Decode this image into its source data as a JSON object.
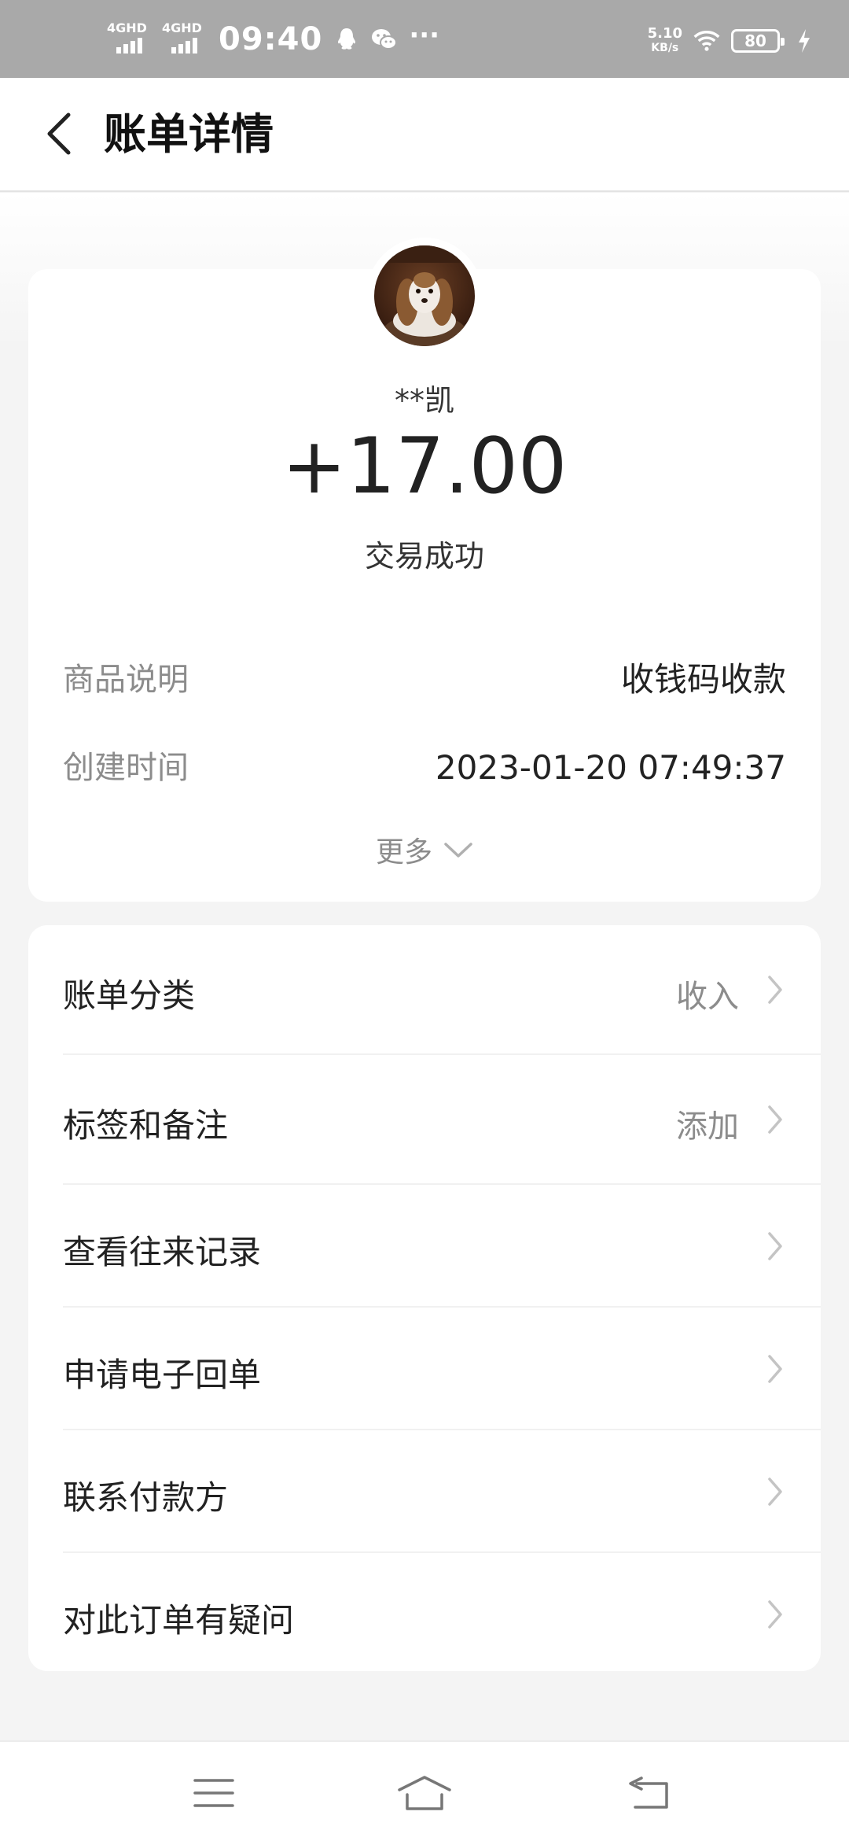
{
  "status_bar": {
    "sim1": "4GHD",
    "sim2": "4GHD",
    "time": "09:40",
    "icons": [
      "qq-icon",
      "wechat-icon",
      "more-dots-icon"
    ],
    "dots": "···",
    "net_speed": "5.10",
    "net_unit": "KB/s",
    "battery": "80"
  },
  "header": {
    "title": "账单详情",
    "back_icon": "chevron-left-icon"
  },
  "summary": {
    "payer": "**凯",
    "amount": "+17.00",
    "status": "交易成功",
    "details": [
      {
        "key": "商品说明",
        "value": "收钱码收款"
      },
      {
        "key": "创建时间",
        "value": "2023-01-20 07:49:37"
      }
    ],
    "more_label": "更多"
  },
  "actions": [
    {
      "label": "账单分类",
      "value": "收入"
    },
    {
      "label": "标签和备注",
      "value": "添加"
    },
    {
      "label": "查看往来记录",
      "value": ""
    },
    {
      "label": "申请电子回单",
      "value": ""
    },
    {
      "label": "联系付款方",
      "value": ""
    },
    {
      "label": "对此订单有疑问",
      "value": ""
    }
  ],
  "bottom_nav": [
    "menu-icon",
    "home-icon",
    "back-icon"
  ],
  "colors": {
    "status_bar": "#a9a9a9",
    "background": "#f4f4f4",
    "card": "#ffffff",
    "secondary_text": "#8c8c8c"
  }
}
